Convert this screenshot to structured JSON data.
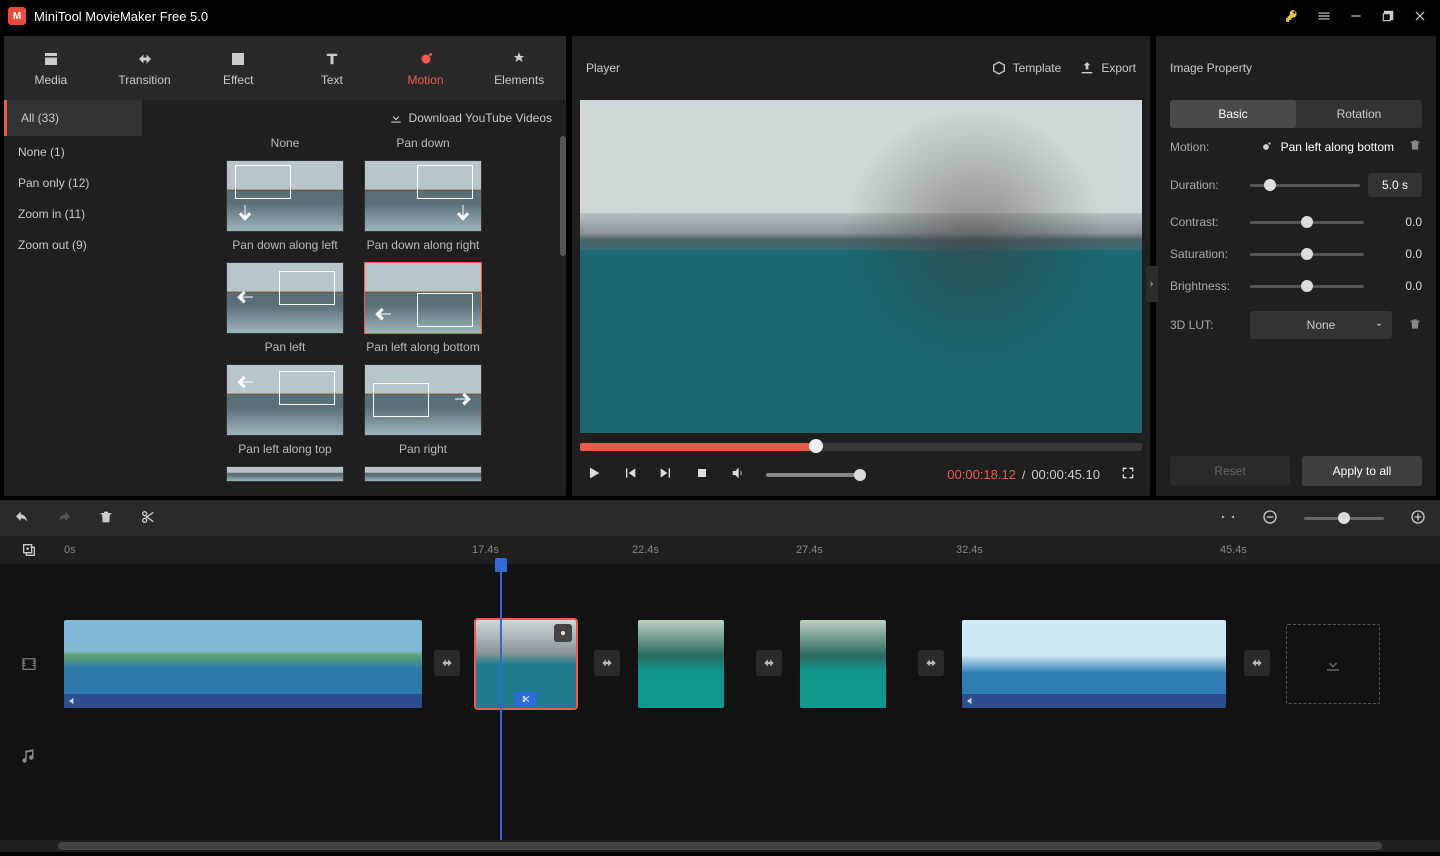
{
  "app": {
    "title": "MiniTool MovieMaker Free 5.0"
  },
  "tabs": [
    {
      "id": "media",
      "label": "Media"
    },
    {
      "id": "transition",
      "label": "Transition"
    },
    {
      "id": "effect",
      "label": "Effect"
    },
    {
      "id": "text",
      "label": "Text"
    },
    {
      "id": "motion",
      "label": "Motion"
    },
    {
      "id": "elements",
      "label": "Elements"
    }
  ],
  "activeTab": "motion",
  "categories": {
    "all": "All (33)",
    "items": [
      "None (1)",
      "Pan only (12)",
      "Zoom in (11)",
      "Zoom out (9)"
    ]
  },
  "download_label": "Download YouTube Videos",
  "motions": [
    {
      "label": "None"
    },
    {
      "label": "Pan down"
    },
    {
      "label": "Pan down along left"
    },
    {
      "label": "Pan down along right"
    },
    {
      "label": "Pan left"
    },
    {
      "label": "Pan left along bottom",
      "selected": true
    },
    {
      "label": "Pan left along top"
    },
    {
      "label": "Pan right"
    }
  ],
  "player": {
    "title": "Player",
    "template": "Template",
    "export": "Export",
    "current": "00:00:18.12",
    "sep": " / ",
    "duration": "00:00:45.10"
  },
  "props": {
    "title": "Image Property",
    "tabs": {
      "basic": "Basic",
      "rotation": "Rotation"
    },
    "motion": {
      "label": "Motion:",
      "value": "Pan left along bottom"
    },
    "duration": {
      "label": "Duration:",
      "value": "5.0 s"
    },
    "contrast": {
      "label": "Contrast:",
      "value": "0.0"
    },
    "saturation": {
      "label": "Saturation:",
      "value": "0.0"
    },
    "brightness": {
      "label": "Brightness:",
      "value": "0.0"
    },
    "lut": {
      "label": "3D LUT:",
      "value": "None"
    },
    "reset": "Reset",
    "apply": "Apply to all"
  },
  "ruler": [
    "0s",
    "17.4s",
    "22.4s",
    "27.4s",
    "32.4s",
    "45.4s"
  ],
  "rulerPos": [
    64,
    472,
    632,
    796,
    956,
    1220
  ]
}
